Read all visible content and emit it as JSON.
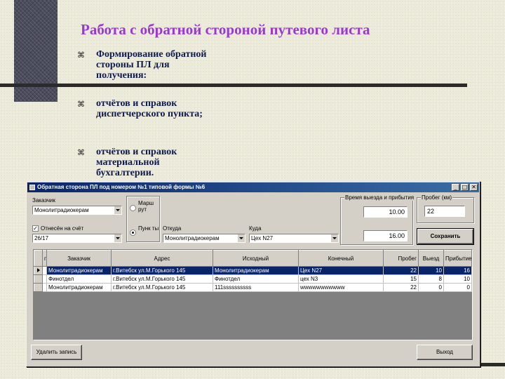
{
  "slide": {
    "title": "Работа с обратной стороной путевого листа",
    "bullets": [
      "Формирование обратной стороны ПЛ для получения:",
      "отчётов и справок диспетчерского пункта;",
      "отчётов и справок материальной бухгалтерии."
    ]
  },
  "window": {
    "title": "Обратная сторона ПЛ под номером №1 типовой формы №6",
    "controls": {
      "minimize": "_",
      "maximize": "□",
      "close": "✕"
    }
  },
  "form": {
    "customer_label": "Заказчик",
    "customer_value": "Монолитрадиокерам",
    "reported_label": "Отнесён на счёт",
    "reported_checked": true,
    "reported_value": "26/17",
    "radio_route_label": "Марш рут",
    "radio_points_label": "Пунк ты",
    "from_label": "Откуда",
    "from_value": "Монолитрадиокерам",
    "to_label": "Куда",
    "to_value": "Цех N27",
    "time_group_label": "Время выезда и прибытия",
    "departure_time": "10.00",
    "arrival_time": "16.00",
    "mileage_group_label": "Пробег (км)",
    "mileage_value": "22",
    "save_label": "Сохранить",
    "delete_label": "Удалить запись",
    "exit_label": "Выход"
  },
  "table": {
    "columns": [
      "г",
      "Заказчик",
      "Адрес",
      "Исходный",
      "Конечный",
      "Пробег",
      "Выезд",
      "Прибытие"
    ],
    "rows": [
      [
        "Монолитрадиокерам",
        "г.Витебск ул.М.Горького 145",
        "Монолитрадиокерам",
        "Цех N27",
        "22",
        "10",
        "16"
      ],
      [
        "Финотдел",
        "г.Витебск ул.М.Горького 145",
        "Финотдел",
        "цех N3",
        "15",
        "8",
        "10"
      ],
      [
        "Монолитрадиокерам",
        "г.Витебск ул.М.Горького 145",
        "111ssssssssss",
        "wwwwwwwwwww",
        "22",
        "0",
        "0"
      ]
    ]
  }
}
